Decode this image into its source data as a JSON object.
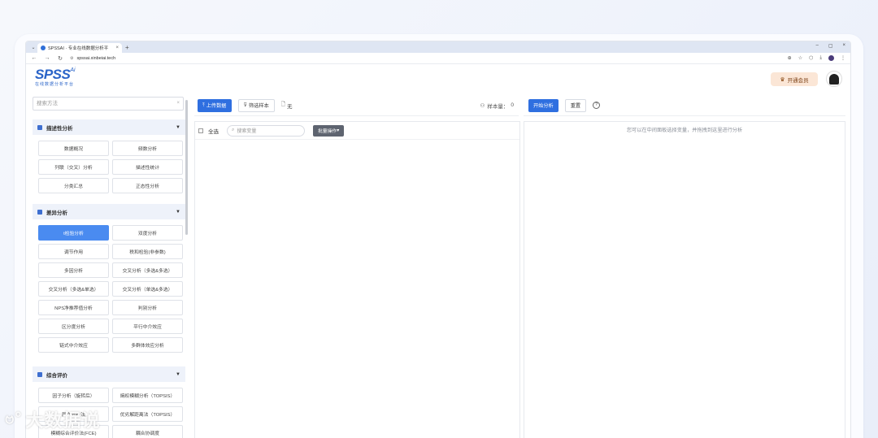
{
  "browser": {
    "tab_title": "SPSSAI · 专业在线数据分析平",
    "tab_dropdown": "⌄",
    "tab_close": "×",
    "new_tab": "+",
    "window_controls": [
      "–",
      "▢",
      "×"
    ],
    "url": "spssai.xinbeiai.tech",
    "nav": [
      "←",
      "→",
      "↻"
    ],
    "addr_icons": [
      "⊕",
      "☆",
      "⬡",
      "⤓",
      "⋮"
    ]
  },
  "header": {
    "logo_text": "SPSS",
    "logo_ai": "Ai",
    "logo_sub": "在线数据分析平台",
    "vip_label": "开通会员"
  },
  "left": {
    "search_placeholder": "搜索方法",
    "search_clear": "×",
    "sections": [
      {
        "title": "描述性分析",
        "items": [
          "数据概况",
          "频数分析",
          "列联（交叉）分析",
          "描述性统计",
          "分类汇总",
          "正态性分析"
        ]
      },
      {
        "title": "差异分析",
        "items": [
          "t检验分析",
          "双度分析",
          "调节作用",
          "秩和检验(非参数)",
          "多因分析",
          "交叉分析（多选&多选）",
          "交叉分析（多选&单选）",
          "交叉分析（单选&多选）",
          "NPS净推荐值分析",
          "判别分析",
          "区分度分析",
          "平行中介效应",
          "链式中介效应",
          "多群体效应分析"
        ]
      },
      {
        "title": "综合评价",
        "items": [
          "因子分析（旋转后）",
          "熵权模糊分析（TOPSIS）",
          "层次分析法",
          "优劣解距离法（TOPSIS）",
          "模糊综合评价法(FCE)",
          "耦合协调度"
        ]
      }
    ],
    "active_item": "t检验分析"
  },
  "center": {
    "upload_label": "上传数据",
    "filter_label": "筛选样本",
    "none_label": "无",
    "sample_count_label": "样本量：",
    "sample_count": "0",
    "select_all": "全选",
    "var_search_placeholder": "搜索变量",
    "batch_label": "批量操作"
  },
  "right": {
    "start_label": "开始分析",
    "reset_label": "重置",
    "help": "?",
    "hint": "您可以在中间面板选择变量，并拖拽到这里进行分析"
  },
  "watermark": "大数据说"
}
